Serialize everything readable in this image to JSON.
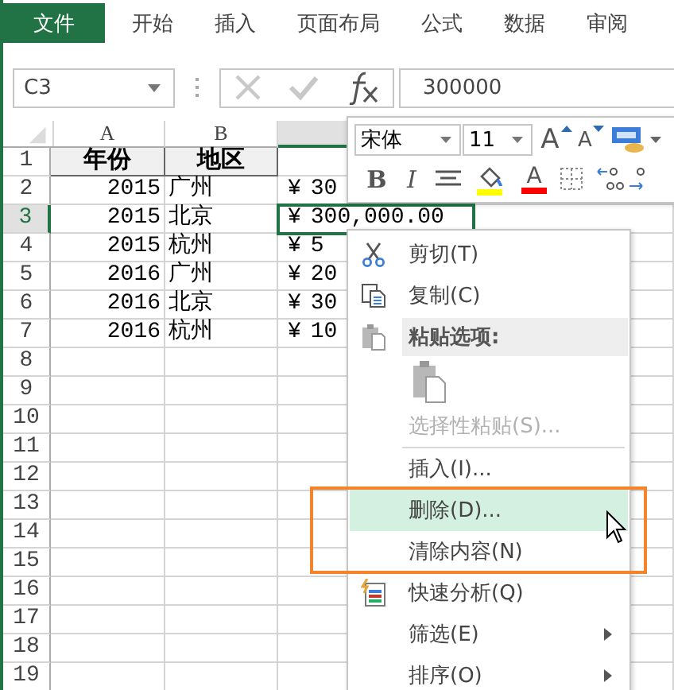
{
  "ribbon_tabs": [
    {
      "label": "文件",
      "selected": true
    },
    {
      "label": "开始",
      "selected": false
    },
    {
      "label": "插入",
      "selected": false
    },
    {
      "label": "页面布局",
      "selected": false
    },
    {
      "label": "公式",
      "selected": false
    },
    {
      "label": "数据",
      "selected": false
    },
    {
      "label": "审阅",
      "selected": false
    }
  ],
  "name_box": {
    "value": "C3"
  },
  "formula_bar": {
    "value": "300000"
  },
  "sheet": {
    "columns": [
      {
        "label": "A",
        "selected": false
      },
      {
        "label": "B",
        "selected": false
      },
      {
        "selected": true
      }
    ],
    "rows": [
      {
        "number": "1",
        "selected": false,
        "kind": "header",
        "year": "年份",
        "region": "地区"
      },
      {
        "number": "2",
        "selected": false,
        "kind": "data",
        "year": "2015",
        "region": "广州",
        "currency": "¥",
        "amount": "30"
      },
      {
        "number": "3",
        "selected": true,
        "kind": "data",
        "year": "2015",
        "region": "北京",
        "currency": "¥",
        "amount": "300,000.00"
      },
      {
        "number": "4",
        "selected": false,
        "kind": "data",
        "year": "2015",
        "region": "杭州",
        "currency": "¥",
        "amount": "5"
      },
      {
        "number": "5",
        "selected": false,
        "kind": "data",
        "year": "2016",
        "region": "广州",
        "currency": "¥",
        "amount": "20"
      },
      {
        "number": "6",
        "selected": false,
        "kind": "data",
        "year": "2016",
        "region": "北京",
        "currency": "¥",
        "amount": "30"
      },
      {
        "number": "7",
        "selected": false,
        "kind": "data",
        "year": "2016",
        "region": "杭州",
        "currency": "¥",
        "amount": "10"
      },
      {
        "number": "8",
        "selected": false,
        "kind": "empty"
      },
      {
        "number": "9",
        "selected": false,
        "kind": "empty"
      },
      {
        "number": "10",
        "selected": false,
        "kind": "empty"
      },
      {
        "number": "11",
        "selected": false,
        "kind": "empty"
      },
      {
        "number": "12",
        "selected": false,
        "kind": "empty"
      },
      {
        "number": "13",
        "selected": false,
        "kind": "empty"
      },
      {
        "number": "14",
        "selected": false,
        "kind": "empty"
      },
      {
        "number": "15",
        "selected": false,
        "kind": "empty"
      },
      {
        "number": "16",
        "selected": false,
        "kind": "empty"
      },
      {
        "number": "17",
        "selected": false,
        "kind": "empty"
      },
      {
        "number": "18",
        "selected": false,
        "kind": "empty"
      },
      {
        "number": "19",
        "selected": false,
        "kind": "empty"
      }
    ]
  },
  "mini_toolbar": {
    "font": "宋体",
    "size": "11",
    "row_1": [
      {
        "kind": "grow-font",
        "label": "A"
      },
      {
        "kind": "shrink-font",
        "label": "A"
      },
      {
        "kind": "format"
      }
    ],
    "row_2": [
      {
        "kind": "bold",
        "label": "B"
      },
      {
        "kind": "italic",
        "label": "I"
      },
      {
        "kind": "align"
      },
      {
        "kind": "fill",
        "color": "#ffff00"
      },
      {
        "kind": "font-color",
        "label": "A",
        "color": "#ff0000"
      },
      {
        "kind": "borders"
      },
      {
        "kind": "increase-decimal"
      },
      {
        "kind": "decrease-decimal"
      }
    ]
  },
  "context_menu": {
    "items": [
      {
        "kind": "cut",
        "label": "剪切(T)",
        "disabled": false,
        "selected": false,
        "annotated": false
      },
      {
        "kind": "copy",
        "label": "复制(C)",
        "disabled": false,
        "selected": false,
        "annotated": false
      },
      {
        "kind": "paste-header",
        "label": "粘贴选项:",
        "disabled": false,
        "selected": false,
        "annotated": false
      },
      {
        "kind": "paste-options",
        "disabled": false,
        "selected": false,
        "annotated": false
      },
      {
        "kind": "plain",
        "label": "选择性粘贴(S)...",
        "disabled": true,
        "selected": false,
        "annotated": false
      },
      {
        "kind": "plain",
        "label": "插入(I)...",
        "disabled": false,
        "selected": false,
        "annotated": false,
        "separator_before": true
      },
      {
        "kind": "plain",
        "label": "删除(D)...",
        "disabled": false,
        "selected": true,
        "annotated": true
      },
      {
        "kind": "plain",
        "label": "清除内容(N)",
        "disabled": false,
        "selected": false,
        "annotated": true
      },
      {
        "kind": "quick-analysis",
        "label": "快速分析(Q)",
        "disabled": false,
        "selected": false,
        "annotated": false
      },
      {
        "kind": "plain",
        "label": "筛选(E)",
        "disabled": false,
        "selected": false,
        "annotated": false,
        "submenu": true
      },
      {
        "kind": "plain",
        "label": "排序(O)",
        "disabled": false,
        "selected": false,
        "annotated": false,
        "submenu": true
      }
    ]
  }
}
